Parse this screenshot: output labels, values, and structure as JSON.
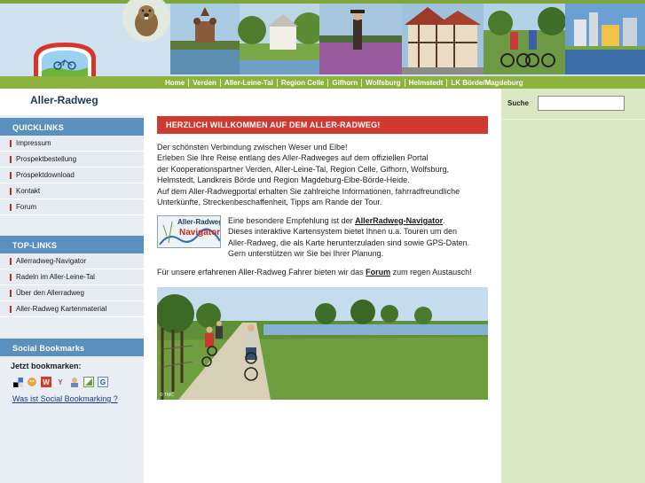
{
  "nav": [
    "Home",
    "Verden",
    "Aller-Leine-Tal",
    "Region Celle",
    "Gifhorn",
    "Wolfsburg",
    "Helmstedt",
    "LK Börde/Magdeburg"
  ],
  "sidebar": {
    "site_title": "Aller-Radweg",
    "quicklinks_title": "QUICKLINKS",
    "quicklinks": [
      "Impressum",
      "Prospektbestellung",
      "Prospektdownload",
      "Kontakt",
      "Forum"
    ],
    "toplinks_title": "TOP-LINKS",
    "toplinks": [
      "Allerradweg-Navigator",
      "Radeln im Aller-Leine-Tal",
      "Über den Allerradweg",
      "Aller-Radweg Kartenmaterial"
    ],
    "bookmarks_title": "Social Bookmarks",
    "bookmark_label": "Jetzt bookmarken:",
    "bookmark_link": "Was ist Social Bookmarking ?"
  },
  "search": {
    "label": "Suche",
    "value": ""
  },
  "main": {
    "welcome": "HERZLICH WILLKOMMEN AUF DEM ALLER-RADWEG!",
    "intro": [
      "Der schönsten Verbindung zwischen Weser und Elbe!",
      "Erleben Sie Ihre Reise entlang des Aller-Radweges auf dem offiziellen Portal",
      "der Kooperationspartner Verden, Aller-Leine-Tal, Region Celle, Gifhorn, Wolfsburg,",
      "Helmstedt, Landkreis Börde und Region Magdeburg-Elbe-Börde-Heide.",
      "Auf dem Aller-Radwegportal erhalten Sie zahlreiche Informationen, fahrradfreundliche",
      "Unterkünfte, Streckenbeschaffenheit, Tipps am Rande der Tour."
    ],
    "rec_pre": "Eine besondere Empfehlung ist der ",
    "rec_link": "AllerRadweg-Navigator",
    "rec_post": ".",
    "rec_lines": [
      "Dieses interaktive Kartensystem bietet Ihnen u.a. Touren um den",
      "Aller-Radweg, die als Karte herunterzuladen sind sowie GPS-Daten.",
      "Gern unterstützen wir Sie bei Ihrer Planung."
    ],
    "navigator_logo_top": "Aller-Radweg",
    "navigator_logo_bottom": "Navigator",
    "forum_pre": "Für unsere erfahrenen Aller-Radweg Fahrer bieten wir das ",
    "forum_link": "Forum",
    "forum_post": " zum regen Austausch!",
    "photo_credit": "© TMC"
  },
  "colors": {
    "accent_red": "#cf3a30",
    "nav_green": "#8db23e",
    "section_blue": "#5b8fbe",
    "right_green": "#dbe8c4"
  }
}
